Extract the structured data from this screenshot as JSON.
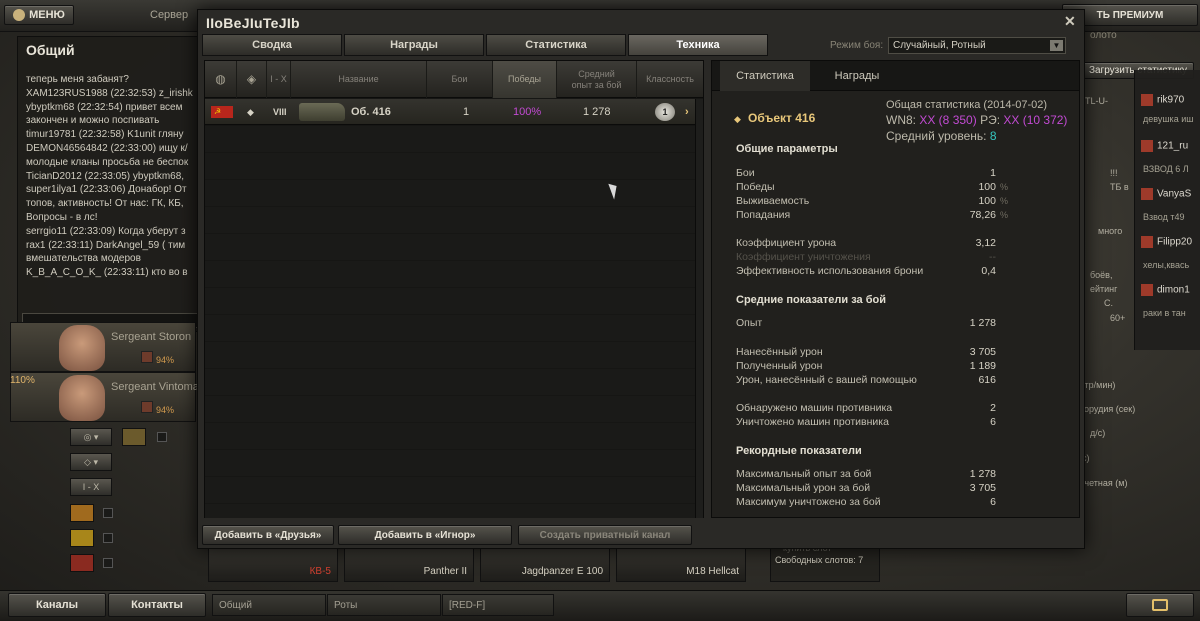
{
  "topbar": {
    "menu_label": "МЕНЮ",
    "server_label": "Сервер",
    "premium_label": "ТЬ ПРЕМИУМ",
    "partial_text": "олото"
  },
  "chat": {
    "title": "Общий",
    "lines": [
      "теперь меня забанят?",
      "XAM123RUS1988 (22:32:53) z_irishk",
      "ybyptkm68 (22:32:54) привет всем",
      "закончен и можно поспивать",
      "timur19781 (22:32:58) K1unit гляну",
      "DEMON46564842 (22:33:00) ищу к/",
      "молодые кланы просьба не беспок",
      "TicianD2012 (22:33:05) ybyptkm68,",
      "super1ilya1 (22:33:06) Донабор! От",
      "топов, активность! От нас: ГК, КБ,",
      "Вопросы - в лс!",
      "serrgio11 (22:33:09) Когда уберут з",
      "rax1 (22:33:11) DarkAngel_59 ( тим",
      "вмешательства модеров",
      "K_B_A_C_O_K_ (22:33:11) кто во в"
    ]
  },
  "crew": [
    {
      "rank": "Sergeant Storon",
      "pct": "94%"
    },
    {
      "rank": "Sergeant Vintoma",
      "pct": "94%"
    }
  ],
  "crew_top_pct": "110%",
  "filters": {
    "level_label": "I - X"
  },
  "right_panel": {
    "load_stats": "Загрузить статистику",
    "players": [
      {
        "name": "rik970",
        "sub": "девушка иш"
      },
      {
        "name": "121_ru",
        "sub": "ВЗВОД 6 Л"
      },
      {
        "name": "VanyaS",
        "sub": "Взвод т49"
      },
      {
        "name": "Filipp20",
        "sub": "хелы,кваcь"
      },
      {
        "name": "dimon1",
        "sub": "раки в тан"
      }
    ],
    "bg_texts": [
      "TL-U-",
      "!!!",
      "ТБ в",
      "много",
      "боёв,",
      "ейтинг",
      "С.",
      "60+",
      "стр/мин)",
      "орудия (сек)",
      "д/с)",
      "с)",
      "счетная (м)"
    ]
  },
  "hangar_slots": [
    {
      "name": "КВ-5",
      "red": true
    },
    {
      "name": "Panther II",
      "red": false
    },
    {
      "name": "Jagdpanzer E 100",
      "red": false
    },
    {
      "name": "M18 Hellcat",
      "red": false
    }
  ],
  "slots_info": {
    "line1": "купить слот",
    "line2": "Свободных слотов: 7"
  },
  "bottombar": {
    "channels": "Каналы",
    "contacts": "Контакты",
    "chat_tabs": [
      "Общий",
      "Роты",
      "[RED-F]"
    ]
  },
  "dialog": {
    "title": "IIoBeJIuTeJIb",
    "close": "✕",
    "tabs": [
      "Сводка",
      "Награды",
      "Статистика",
      "Техника"
    ],
    "active_tab": 3,
    "mode_label": "Режим боя:",
    "mode_value": "Случайный, Ротный",
    "table": {
      "headers": {
        "nation": "",
        "type": "",
        "level": "I - X",
        "name": "Название",
        "battles": "Бои",
        "wins": "Победы",
        "avg_xp": "Средний опыт за бой",
        "mastery": "Классность"
      },
      "row": {
        "tier": "VIII",
        "name": "Об. 416",
        "battles": "1",
        "wins": "100%",
        "avg_xp": "1 278",
        "mastery": "1"
      }
    },
    "stats": {
      "tabs": [
        "Статистика",
        "Награды"
      ],
      "vehicle": "Объект 416",
      "summary_title": "Общая статистика (2014-07-02)",
      "wn8_label": "WN8:",
      "wn8_value": "XX (8 350)",
      "re_label": "РЭ:",
      "re_value": "XX (10 372)",
      "avg_level_label": "Средний уровень:",
      "avg_level_value": "8",
      "general_title": "Общие параметры",
      "general": [
        {
          "label": "Бои",
          "value": "1",
          "pct": ""
        },
        {
          "label": "Победы",
          "value": "100",
          "pct": "%"
        },
        {
          "label": "Выживаемость",
          "value": "100",
          "pct": "%"
        },
        {
          "label": "Попадания",
          "value": "78,26",
          "pct": "%"
        }
      ],
      "ratios": [
        {
          "label": "Коэффициент урона",
          "value": "3,12",
          "dim": false
        },
        {
          "label": "Коэффициент уничтожения",
          "value": "--",
          "dim": true
        },
        {
          "label": "Эффективность использования брони",
          "value": "0,4",
          "dim": false
        }
      ],
      "avg_title": "Средние показатели за бой",
      "avg_xp": {
        "label": "Опыт",
        "value": "1 278"
      },
      "avg_damage": [
        {
          "label": "Нанесённый урон",
          "value": "3 705"
        },
        {
          "label": "Полученный урон",
          "value": "1 189"
        },
        {
          "label": "Урон, нанесённый с вашей помощью",
          "value": "616"
        }
      ],
      "avg_enemies": [
        {
          "label": "Обнаружено машин противника",
          "value": "2"
        },
        {
          "label": "Уничтожено машин противника",
          "value": "6"
        }
      ],
      "records_title": "Рекордные показатели",
      "records": [
        {
          "label": "Максимальный опыт за бой",
          "value": "1 278"
        },
        {
          "label": "Максимальный урон за бой",
          "value": "3 705"
        },
        {
          "label": "Максимум уничтожено за бой",
          "value": "6"
        }
      ]
    },
    "buttons": {
      "add_friend": "Добавить в «Друзья»",
      "add_ignore": "Добавить в «Игнор»",
      "private_channel": "Создать приватный канал"
    }
  },
  "colors": {
    "purple": "#c24ad3",
    "teal": "#35c7c0",
    "gold": "#e8c77a"
  }
}
